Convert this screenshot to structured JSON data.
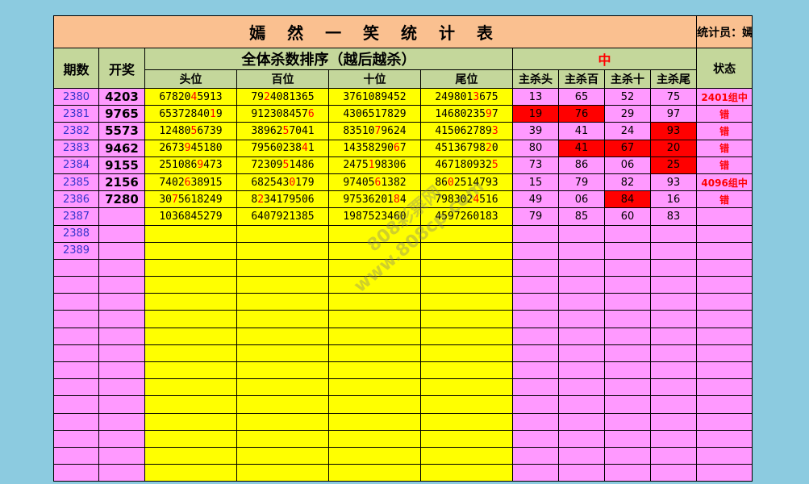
{
  "title": "嫣 然 一 笑 统 计 表",
  "statistician": "统计员：嫣然一笑",
  "headers": {
    "period": "期数",
    "draw": "开奖",
    "group": "全体杀数排序（越后越杀）",
    "zhong": "中",
    "status": "状态",
    "pos": [
      "头位",
      "百位",
      "十位",
      "尾位"
    ],
    "kills": [
      "主杀头",
      "主杀百",
      "主杀十",
      "主杀尾"
    ]
  },
  "rows": [
    {
      "period": "2380",
      "draw": "4203",
      "seq": [
        [
          "67820",
          "4",
          "5913"
        ],
        [
          "79",
          "2",
          "4081365"
        ],
        [
          "37610",
          "",
          "89452"
        ],
        [
          "249801",
          "3",
          "675"
        ]
      ],
      "kills": [
        "13",
        "65",
        "52",
        "75"
      ],
      "hits": [
        false,
        false,
        false,
        false
      ],
      "status": "2401组中"
    },
    {
      "period": "2381",
      "draw": "9765",
      "seq": [
        [
          "65372840",
          "1",
          "9"
        ],
        [
          "912308457",
          "6",
          ""
        ],
        [
          "4306517829",
          "",
          ""
        ],
        [
          "14680235",
          "9",
          "7"
        ]
      ],
      "kills": [
        "19",
        "76",
        "29",
        "97"
      ],
      "hits": [
        true,
        true,
        false,
        false
      ],
      "status": "错"
    },
    {
      "period": "2382",
      "draw": "5573",
      "seq": [
        [
          "12480",
          "5",
          "6739"
        ],
        [
          "38962",
          "5",
          "7041"
        ],
        [
          "83510",
          "7",
          "9624"
        ],
        [
          "415062789",
          "3",
          ""
        ]
      ],
      "kills": [
        "39",
        "41",
        "24",
        "93"
      ],
      "hits": [
        false,
        false,
        false,
        true
      ],
      "status": "错"
    },
    {
      "period": "2383",
      "draw": "9462",
      "seq": [
        [
          "2673",
          "9",
          "45180"
        ],
        [
          "79560238",
          "4",
          "1"
        ],
        [
          "14358290",
          "6",
          "7"
        ],
        [
          "45136798",
          "2",
          "0"
        ]
      ],
      "kills": [
        "80",
        "41",
        "67",
        "20"
      ],
      "hits": [
        false,
        true,
        true,
        true
      ],
      "status": "错"
    },
    {
      "period": "2384",
      "draw": "9155",
      "seq": [
        [
          "251086",
          "9",
          "473"
        ],
        [
          "72309",
          "5",
          "1486"
        ],
        [
          "2475",
          "1",
          "98306"
        ],
        [
          "467180932",
          "5",
          ""
        ]
      ],
      "kills": [
        "73",
        "86",
        "06",
        "25"
      ],
      "hits": [
        false,
        false,
        false,
        true
      ],
      "status": "错"
    },
    {
      "period": "2385",
      "draw": "2156",
      "seq": [
        [
          "7402",
          "6",
          "38915"
        ],
        [
          "682543",
          "0",
          "179"
        ],
        [
          "97405",
          "6",
          "1382"
        ],
        [
          "86",
          "0",
          "2514793"
        ]
      ],
      "kills": [
        "15",
        "79",
        "82",
        "93"
      ],
      "hits": [
        false,
        false,
        false,
        false
      ],
      "status": "4096组中"
    },
    {
      "period": "2386",
      "draw": "7280",
      "seq": [
        [
          "30",
          "7",
          "5618249"
        ],
        [
          "8",
          "2",
          "34179506"
        ],
        [
          "97536201",
          "8",
          "4"
        ],
        [
          "798302",
          "4",
          "516"
        ]
      ],
      "kills": [
        "49",
        "06",
        "84",
        "16"
      ],
      "hits": [
        false,
        false,
        true,
        false
      ],
      "status": "错"
    },
    {
      "period": "2387",
      "draw": "",
      "seq": [
        [
          "1036845279",
          "",
          ""
        ],
        [
          "6407921385",
          "",
          ""
        ],
        [
          "1987523460",
          "",
          ""
        ],
        [
          "4597260183",
          "",
          ""
        ]
      ],
      "kills": [
        "79",
        "85",
        "60",
        "83"
      ],
      "hits": [
        false,
        false,
        false,
        false
      ],
      "status": ""
    },
    {
      "period": "2388",
      "draw": "",
      "seq": [
        [
          "",
          "",
          ""
        ],
        [
          "",
          "",
          ""
        ],
        [
          "",
          "",
          ""
        ],
        [
          "",
          "",
          ""
        ]
      ],
      "kills": [
        "",
        "",
        "",
        ""
      ],
      "hits": [
        false,
        false,
        false,
        false
      ],
      "status": ""
    },
    {
      "period": "2389",
      "draw": "",
      "seq": [
        [
          "",
          "",
          ""
        ],
        [
          "",
          "",
          ""
        ],
        [
          "",
          "",
          ""
        ],
        [
          "",
          "",
          ""
        ]
      ],
      "kills": [
        "",
        "",
        "",
        ""
      ],
      "hits": [
        false,
        false,
        false,
        false
      ],
      "status": ""
    }
  ],
  "empty_rows": 13,
  "watermark": [
    "808彩票网",
    "www.808cp.com"
  ]
}
